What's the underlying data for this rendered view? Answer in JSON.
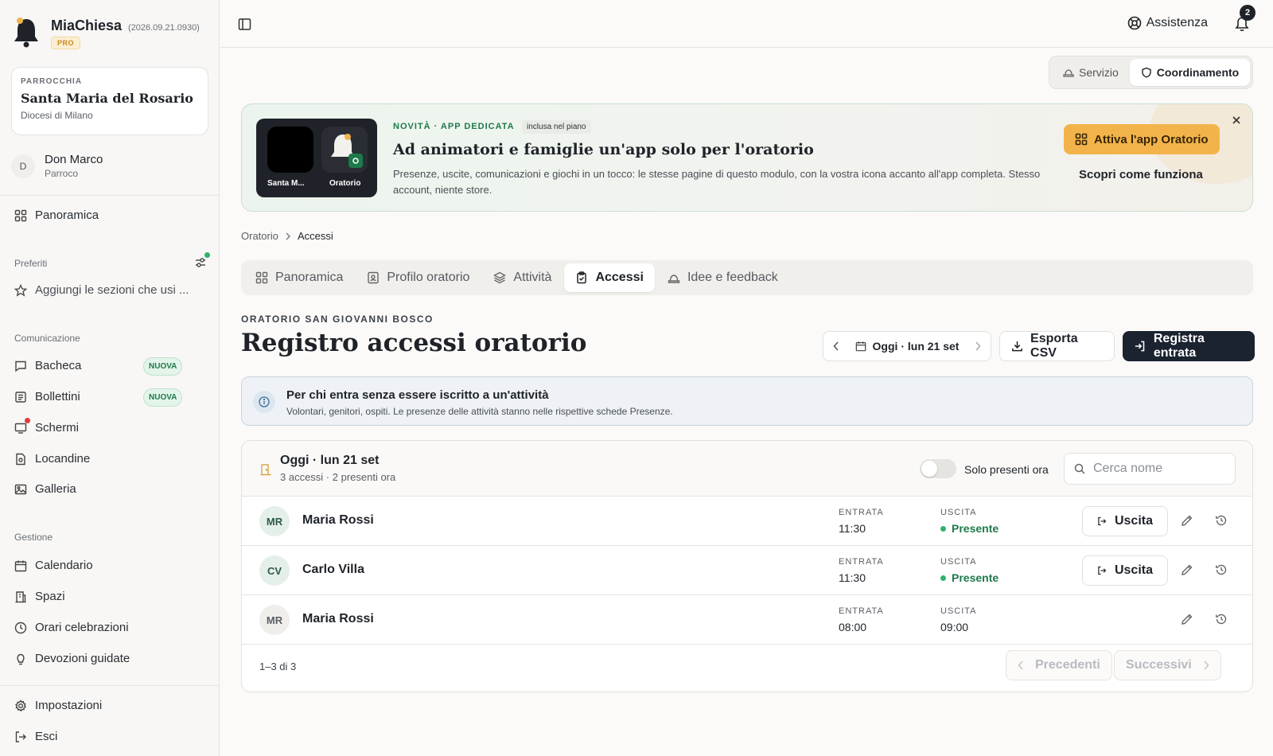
{
  "app": {
    "name": "MiaChiesa",
    "version": "(2026.09.21.0930)",
    "plan_badge": "PRO"
  },
  "parish": {
    "label": "PARROCCHIA",
    "name": "Santa Maria del Rosario",
    "diocese": "Diocesi di Milano"
  },
  "user": {
    "initial": "D",
    "name": "Don Marco",
    "role": "Parroco"
  },
  "sidebar": {
    "overview": "Panoramica",
    "favorites_label": "Preferiti",
    "favorites_add": "Aggiungi le sezioni che usi ...",
    "communication_label": "Comunicazione",
    "communication": [
      {
        "label": "Bacheca",
        "badge": "NUOVA"
      },
      {
        "label": "Bollettini",
        "badge": "NUOVA"
      },
      {
        "label": "Schermi"
      },
      {
        "label": "Locandine"
      },
      {
        "label": "Galleria"
      }
    ],
    "management_label": "Gestione",
    "management": [
      {
        "label": "Calendario"
      },
      {
        "label": "Spazi"
      },
      {
        "label": "Orari celebrazioni"
      },
      {
        "label": "Devozioni guidate"
      }
    ],
    "settings": "Impostazioni",
    "logout": "Esci"
  },
  "topbar": {
    "assist": "Assistenza",
    "notifications_count": "2"
  },
  "role_switch": {
    "options": [
      "Servizio",
      "Coordinamento"
    ],
    "active": "Coordinamento"
  },
  "promo": {
    "kicker": "NOVITÀ · APP DEDICATA",
    "included": "inclusa nel piano",
    "title": "Ad animatori e famiglie un'app solo per l'oratorio",
    "description": "Presenze, uscite, comunicazioni e giochi in un tocco: le stesse pagine di questo modulo, con la vostra icona accanto all'app completa. Stesso account, niente store.",
    "app1_label": "Santa M...",
    "app2_label": "Oratorio",
    "cta": "Attiva l'app Oratorio",
    "link": "Scopri come funziona"
  },
  "breadcrumb": [
    "Oratorio",
    "Accessi"
  ],
  "tabs": [
    {
      "label": "Panoramica"
    },
    {
      "label": "Profilo oratorio"
    },
    {
      "label": "Attività"
    },
    {
      "label": "Accessi",
      "active": true
    },
    {
      "label": "Idee e feedback"
    }
  ],
  "page": {
    "kicker": "ORATORIO SAN GIOVANNI BOSCO",
    "title": "Registro accessi oratorio",
    "date": "Oggi · lun 21 set",
    "export": "Esporta CSV",
    "register": "Registra entrata"
  },
  "info": {
    "title": "Per chi entra senza essere iscritto a un'attività",
    "subtitle": "Volontari, genitori, ospiti. Le presenze delle attività stanno nelle rispettive schede Presenze."
  },
  "card": {
    "title": "Oggi · lun 21 set",
    "subtitle": "3 accessi · 2 presenti ora",
    "filter_label": "Solo presenti ora",
    "filter_on": false,
    "search_placeholder": "Cerca nome",
    "col_entry": "ENTRATA",
    "col_exit": "USCITA",
    "exit_button": "Uscita",
    "present_label": "Presente",
    "rows": [
      {
        "initials": "MR",
        "name": "Maria Rossi",
        "entry": "11:30",
        "exit": null,
        "present": true
      },
      {
        "initials": "CV",
        "name": "Carlo Villa",
        "entry": "11:30",
        "exit": null,
        "present": true
      },
      {
        "initials": "MR",
        "name": "Maria Rossi",
        "entry": "08:00",
        "exit": "09:00",
        "present": false
      }
    ],
    "pagination": {
      "summary": "1–3 di 3",
      "prev": "Precedenti",
      "next": "Successivi"
    }
  },
  "colors": {
    "accent_green": "#1d7a4a",
    "cta_orange": "#f2b44a",
    "dark_button": "#1b2230",
    "alert_red": "#e23b3b"
  },
  "icons": {
    "brand": "bell-logo-icon",
    "sidebar_toggle": "sidebar-toggle-icon",
    "assist": "lifebuoy-icon",
    "notifications": "bell-icon",
    "close": "close-icon",
    "calendar": "calendar-icon",
    "download": "download-icon",
    "enter": "login-icon",
    "exit": "logout-icon",
    "edit": "pencil-icon",
    "history": "history-icon",
    "search": "search-icon",
    "info": "info-icon"
  }
}
